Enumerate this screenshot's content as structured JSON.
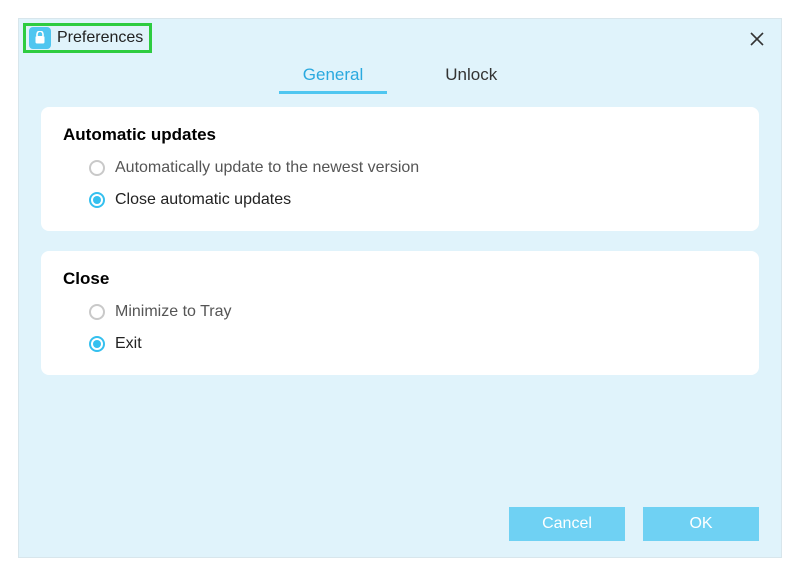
{
  "window": {
    "title": "Preferences"
  },
  "tabs": {
    "general": "General",
    "unlock": "Unlock",
    "active": "general"
  },
  "sections": {
    "updates": {
      "title": "Automatic updates",
      "opt_auto": "Automatically update to the newest version",
      "opt_close": "Close automatic updates",
      "selected": "close"
    },
    "close": {
      "title": "Close",
      "opt_tray": "Minimize to Tray",
      "opt_exit": "Exit",
      "selected": "exit"
    }
  },
  "buttons": {
    "cancel": "Cancel",
    "ok": "OK"
  },
  "colors": {
    "accent": "#4fc6f0",
    "panel_bg": "#e0f3fb",
    "highlight_border": "#2ecc40"
  }
}
